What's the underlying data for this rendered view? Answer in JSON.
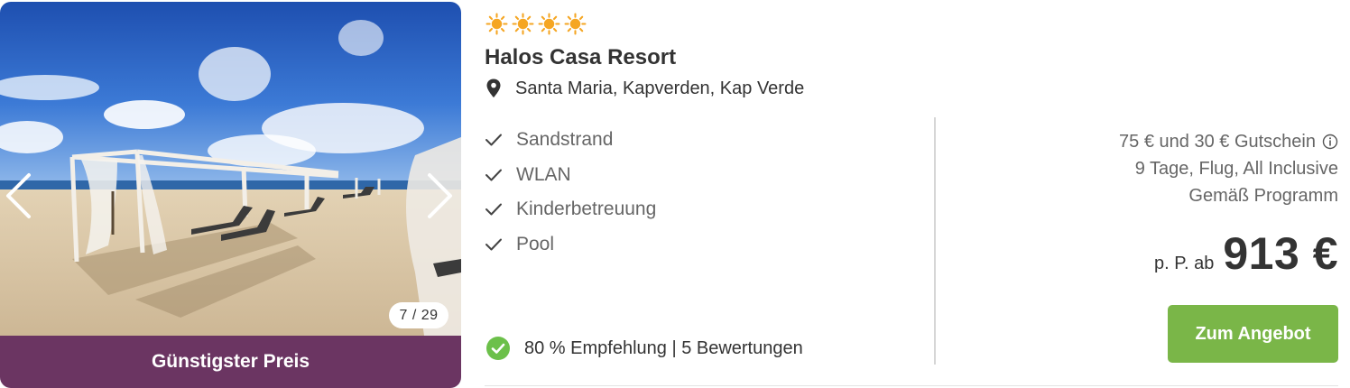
{
  "hotel": {
    "stars": 4,
    "star_icon": "sun-icon",
    "name": "Halos Casa Resort",
    "location": "Santa Maria, Kapverden, Kap Verde"
  },
  "gallery": {
    "counter": "7 / 29",
    "badge": "Günstigster Preis",
    "badge_color": "#6b3562"
  },
  "features": [
    {
      "label": "Sandstrand"
    },
    {
      "label": "WLAN"
    },
    {
      "label": "Kinderbetreuung"
    },
    {
      "label": "Pool"
    }
  ],
  "rating": {
    "text": "80 % Empfehlung | 5 Bewertungen"
  },
  "offer": {
    "voucher": "75 € und 30 € Gutschein",
    "details": "9 Tage, Flug, All Inclusive",
    "program": "Gemäß Programm",
    "price_prefix": "p. P. ab",
    "price": "913 €",
    "cta_label": "Zum Angebot",
    "cta_color": "#7ab648"
  }
}
